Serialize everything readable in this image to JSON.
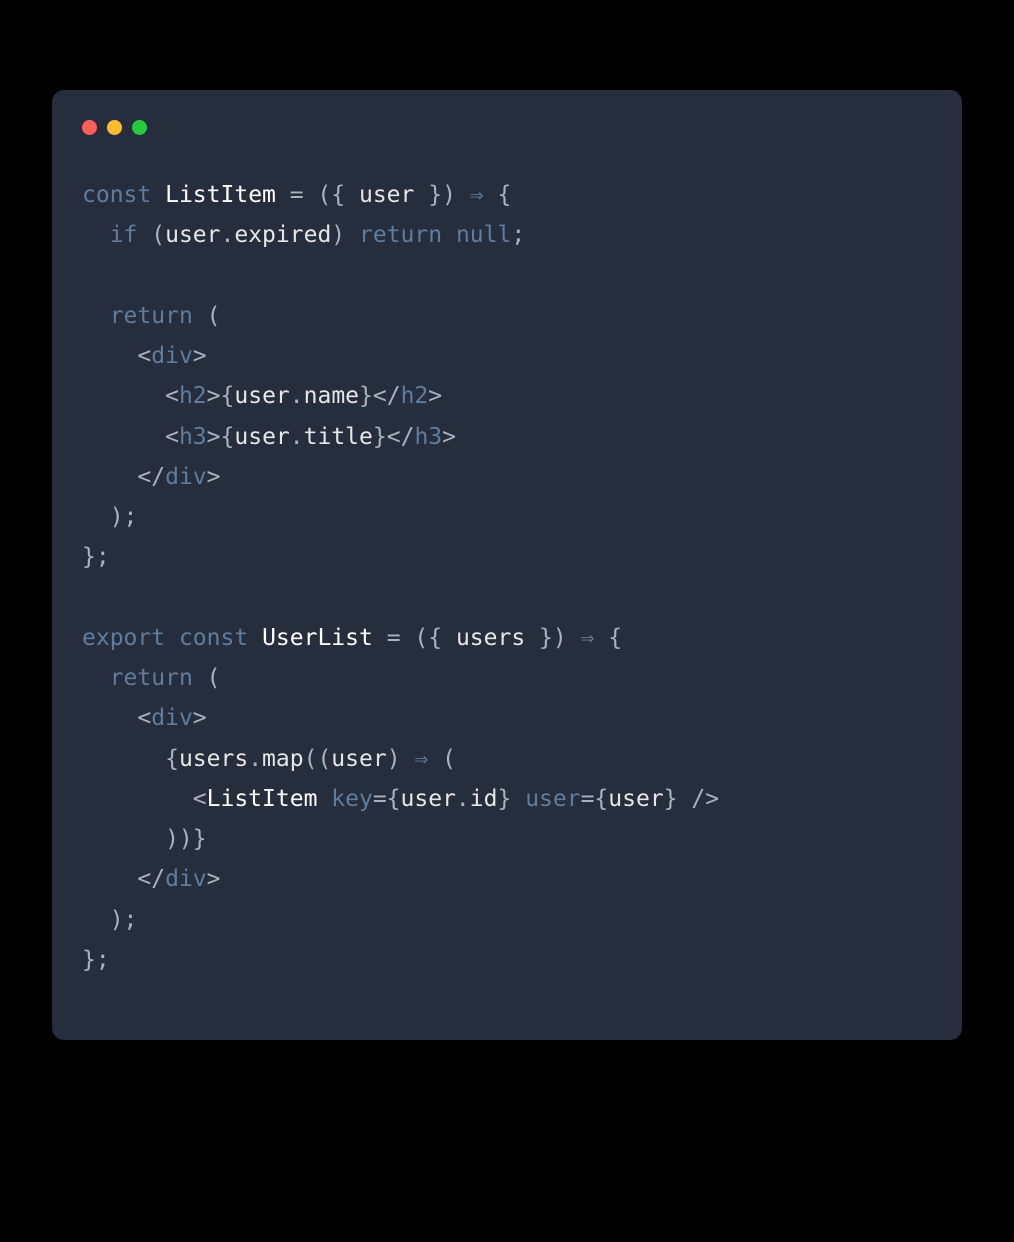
{
  "colors": {
    "page_bg": "#000000",
    "editor_bg": "#262e3d",
    "close": "#ff5f56",
    "minimize": "#ffbd2e",
    "maximize": "#27c93f"
  },
  "traffic_lights": {
    "close_name": "close-icon",
    "min_name": "minimize-icon",
    "max_name": "maximize-icon"
  },
  "code": {
    "tokens": [
      [
        {
          "t": "const",
          "c": "c-const"
        },
        {
          "t": " ",
          "c": "c-punc"
        },
        {
          "t": "ListItem",
          "c": "c-def"
        },
        {
          "t": " = ({ ",
          "c": "c-punc"
        },
        {
          "t": "user",
          "c": "c-prop"
        },
        {
          "t": " }) ",
          "c": "c-punc"
        },
        {
          "t": "⇒",
          "c": "c-arrow"
        },
        {
          "t": " {",
          "c": "c-punc"
        }
      ],
      [
        {
          "t": "  ",
          "c": "c-punc"
        },
        {
          "t": "if",
          "c": "c-kw"
        },
        {
          "t": " (",
          "c": "c-punc"
        },
        {
          "t": "user",
          "c": "c-prop"
        },
        {
          "t": ".",
          "c": "c-punc"
        },
        {
          "t": "expired",
          "c": "c-prop"
        },
        {
          "t": ") ",
          "c": "c-punc"
        },
        {
          "t": "return",
          "c": "c-kw"
        },
        {
          "t": " ",
          "c": "c-punc"
        },
        {
          "t": "null",
          "c": "c-null"
        },
        {
          "t": ";",
          "c": "c-punc"
        }
      ],
      [],
      [
        {
          "t": "  ",
          "c": "c-punc"
        },
        {
          "t": "return",
          "c": "c-kw"
        },
        {
          "t": " (",
          "c": "c-punc"
        }
      ],
      [
        {
          "t": "    ",
          "c": "c-punc"
        },
        {
          "t": "<",
          "c": "c-punc"
        },
        {
          "t": "div",
          "c": "c-tag"
        },
        {
          "t": ">",
          "c": "c-punc"
        }
      ],
      [
        {
          "t": "      ",
          "c": "c-punc"
        },
        {
          "t": "<",
          "c": "c-punc"
        },
        {
          "t": "h2",
          "c": "c-tag"
        },
        {
          "t": ">",
          "c": "c-punc"
        },
        {
          "t": "{",
          "c": "c-punc"
        },
        {
          "t": "user",
          "c": "c-prop"
        },
        {
          "t": ".",
          "c": "c-punc"
        },
        {
          "t": "name",
          "c": "c-prop"
        },
        {
          "t": "}",
          "c": "c-punc"
        },
        {
          "t": "</",
          "c": "c-punc"
        },
        {
          "t": "h2",
          "c": "c-tag"
        },
        {
          "t": ">",
          "c": "c-punc"
        }
      ],
      [
        {
          "t": "      ",
          "c": "c-punc"
        },
        {
          "t": "<",
          "c": "c-punc"
        },
        {
          "t": "h3",
          "c": "c-tag"
        },
        {
          "t": ">",
          "c": "c-punc"
        },
        {
          "t": "{",
          "c": "c-punc"
        },
        {
          "t": "user",
          "c": "c-prop"
        },
        {
          "t": ".",
          "c": "c-punc"
        },
        {
          "t": "title",
          "c": "c-prop"
        },
        {
          "t": "}",
          "c": "c-punc"
        },
        {
          "t": "</",
          "c": "c-punc"
        },
        {
          "t": "h3",
          "c": "c-tag"
        },
        {
          "t": ">",
          "c": "c-punc"
        }
      ],
      [
        {
          "t": "    ",
          "c": "c-punc"
        },
        {
          "t": "</",
          "c": "c-punc"
        },
        {
          "t": "div",
          "c": "c-tag"
        },
        {
          "t": ">",
          "c": "c-punc"
        }
      ],
      [
        {
          "t": "  );",
          "c": "c-punc"
        }
      ],
      [
        {
          "t": "};",
          "c": "c-punc"
        }
      ],
      [],
      [
        {
          "t": "export",
          "c": "c-kw"
        },
        {
          "t": " ",
          "c": "c-punc"
        },
        {
          "t": "const",
          "c": "c-const"
        },
        {
          "t": " ",
          "c": "c-punc"
        },
        {
          "t": "UserList",
          "c": "c-def"
        },
        {
          "t": " = ({ ",
          "c": "c-punc"
        },
        {
          "t": "users",
          "c": "c-prop"
        },
        {
          "t": " }) ",
          "c": "c-punc"
        },
        {
          "t": "⇒",
          "c": "c-arrow"
        },
        {
          "t": " {",
          "c": "c-punc"
        }
      ],
      [
        {
          "t": "  ",
          "c": "c-punc"
        },
        {
          "t": "return",
          "c": "c-kw"
        },
        {
          "t": " (",
          "c": "c-punc"
        }
      ],
      [
        {
          "t": "    ",
          "c": "c-punc"
        },
        {
          "t": "<",
          "c": "c-punc"
        },
        {
          "t": "div",
          "c": "c-tag"
        },
        {
          "t": ">",
          "c": "c-punc"
        }
      ],
      [
        {
          "t": "      {",
          "c": "c-punc"
        },
        {
          "t": "users",
          "c": "c-prop"
        },
        {
          "t": ".",
          "c": "c-punc"
        },
        {
          "t": "map",
          "c": "c-prop"
        },
        {
          "t": "((",
          "c": "c-punc"
        },
        {
          "t": "user",
          "c": "c-prop"
        },
        {
          "t": ") ",
          "c": "c-punc"
        },
        {
          "t": "⇒",
          "c": "c-arrow"
        },
        {
          "t": " (",
          "c": "c-punc"
        }
      ],
      [
        {
          "t": "        ",
          "c": "c-punc"
        },
        {
          "t": "<",
          "c": "c-punc"
        },
        {
          "t": "ListItem",
          "c": "c-def"
        },
        {
          "t": " ",
          "c": "c-punc"
        },
        {
          "t": "key",
          "c": "c-attr"
        },
        {
          "t": "={",
          "c": "c-punc"
        },
        {
          "t": "user",
          "c": "c-prop"
        },
        {
          "t": ".",
          "c": "c-punc"
        },
        {
          "t": "id",
          "c": "c-prop"
        },
        {
          "t": "} ",
          "c": "c-punc"
        },
        {
          "t": "user",
          "c": "c-attr"
        },
        {
          "t": "={",
          "c": "c-punc"
        },
        {
          "t": "user",
          "c": "c-prop"
        },
        {
          "t": "} ",
          "c": "c-punc"
        },
        {
          "t": "/>",
          "c": "c-punc"
        }
      ],
      [
        {
          "t": "      ))}",
          "c": "c-punc"
        }
      ],
      [
        {
          "t": "    ",
          "c": "c-punc"
        },
        {
          "t": "</",
          "c": "c-punc"
        },
        {
          "t": "div",
          "c": "c-tag"
        },
        {
          "t": ">",
          "c": "c-punc"
        }
      ],
      [
        {
          "t": "  );",
          "c": "c-punc"
        }
      ],
      [
        {
          "t": "};",
          "c": "c-punc"
        }
      ]
    ]
  }
}
